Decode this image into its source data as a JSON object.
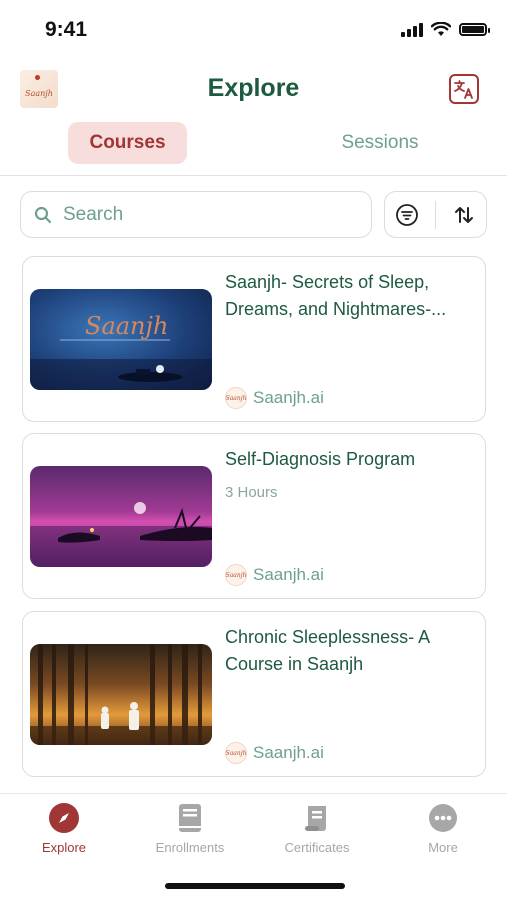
{
  "status_bar": {
    "time": "9:41"
  },
  "header": {
    "title": "Explore",
    "logo_text": "Saanjh"
  },
  "tabs": [
    {
      "label": "Courses",
      "active": true
    },
    {
      "label": "Sessions",
      "active": false
    }
  ],
  "search": {
    "placeholder": "Search",
    "value": ""
  },
  "courses": [
    {
      "title": "Saanjh- Secrets of Sleep, Dreams, and Nightmares-...",
      "meta": "",
      "author": "Saanjh.ai",
      "thumb_text": "Saanjh"
    },
    {
      "title": "Self-Diagnosis Program",
      "meta": "3 Hours",
      "author": "Saanjh.ai"
    },
    {
      "title": "Chronic Sleeplessness- A Course in Saanjh",
      "meta": "",
      "author": "Saanjh.ai"
    }
  ],
  "bottom_nav": [
    {
      "label": "Explore",
      "icon": "compass-icon",
      "active": true
    },
    {
      "label": "Enrollments",
      "icon": "book-icon",
      "active": false
    },
    {
      "label": "Certificates",
      "icon": "scroll-icon",
      "active": false
    },
    {
      "label": "More",
      "icon": "more-dots-icon",
      "active": false
    }
  ],
  "colors": {
    "primary_green": "#1d5a3f",
    "accent_red": "#a03636",
    "muted_green": "#6fa08c"
  }
}
